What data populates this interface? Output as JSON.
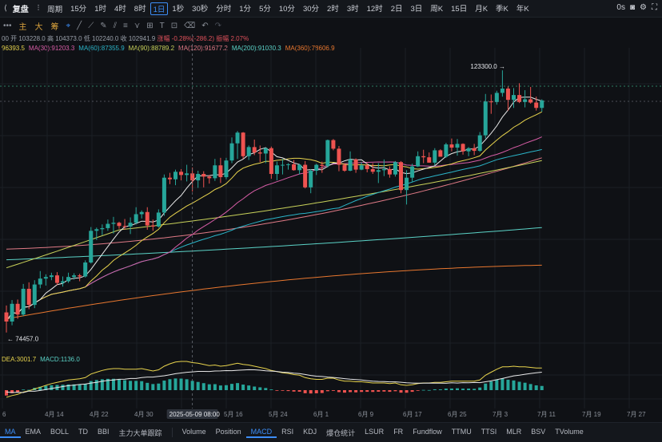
{
  "topbar": {
    "title": "复盘",
    "period_label": "周期",
    "intervals": [
      "15分",
      "1时",
      "4时",
      "8时",
      "1日",
      "1秒",
      "30秒",
      "分时",
      "1分",
      "5分",
      "10分",
      "30分",
      "2时",
      "3时",
      "12时",
      "2日",
      "3日",
      "周K",
      "15日",
      "月K",
      "季K",
      "年K"
    ],
    "active_interval": "1日",
    "right_text": "0s"
  },
  "toolbar": {
    "tabs": [
      "主",
      "大",
      "筹"
    ]
  },
  "ohlc": {
    "prefix": "00",
    "open": "开 103228.0",
    "high": "高 104373.0",
    "low": "低 102240.0",
    "close": "收 102941.9",
    "change": "涨幅 -0.28%(-286.2)",
    "amplitude": "振幅 2.07%"
  },
  "colors": {
    "bull": "#26a69a",
    "bear": "#ef5350",
    "ma7": "#e8e8e8",
    "ma15": "#e8d44d",
    "ma30": "#d75da6",
    "ma60": "#2bb5c9",
    "ma90": "#c9d25a",
    "ma120": "#e07a86",
    "ma200": "#5bd3c7",
    "ma360": "#e8772f",
    "dif": "#e8d44d",
    "dea": "#e8e8e8"
  },
  "ma_legend": [
    {
      "label": "96393.5",
      "color": "#e8d44d"
    },
    {
      "label": "MA(30):91203.3",
      "color": "#d75da6"
    },
    {
      "label": "MA(60):87355.9",
      "color": "#2bb5c9"
    },
    {
      "label": "MA(90):88789.2",
      "color": "#c9d25a"
    },
    {
      "label": "MA(120):91677.2",
      "color": "#e07a86"
    },
    {
      "label": "MA(200):91030.3",
      "color": "#5bd3c7"
    },
    {
      "label": "MA(360):78606.9",
      "color": "#e8772f"
    }
  ],
  "macd_legend": [
    {
      "label": "DEA:3001.7",
      "color": "#e8d44d"
    },
    {
      "label": "MACD:1136.0",
      "color": "#5bd3c7"
    }
  ],
  "chart_data": {
    "type": "candlestick",
    "symbol": "BTC",
    "high_annotation": "123300.0 →",
    "low_annotation": "← 74457.0",
    "crosshair_label": "2025-05-09 08:00",
    "x_ticks": [
      "6",
      "4月 14",
      "4月 22",
      "4月 30",
      "5月 16",
      "5月 24",
      "6月 1",
      "6月 9",
      "6月 17",
      "6月 25",
      "7月 3",
      "7月 11",
      "7月 19",
      "7月 27"
    ],
    "y_range": [
      71000,
      126000
    ],
    "grid": true,
    "dates_start": "2025-04-06",
    "ohlc": [
      [
        78200,
        79500,
        74457,
        76500
      ],
      [
        76500,
        80500,
        75800,
        79800
      ],
      [
        79800,
        80600,
        77000,
        77800
      ],
      [
        77800,
        83500,
        77500,
        82600
      ],
      [
        82600,
        83800,
        78800,
        79600
      ],
      [
        79600,
        84200,
        79000,
        83400
      ],
      [
        83400,
        85900,
        82700,
        84500
      ],
      [
        84500,
        85300,
        83200,
        84800
      ],
      [
        84800,
        85600,
        84200,
        85100
      ],
      [
        85100,
        85700,
        83300,
        83700
      ],
      [
        83700,
        84900,
        83000,
        84000
      ],
      [
        84000,
        85600,
        83700,
        84800
      ],
      [
        84800,
        85500,
        84300,
        85100
      ],
      [
        85100,
        85400,
        84000,
        84900
      ],
      [
        84900,
        87900,
        84700,
        87500
      ],
      [
        87500,
        94100,
        87300,
        93400
      ],
      [
        93400,
        94000,
        91700,
        93700
      ],
      [
        93700,
        94600,
        92600,
        93900
      ],
      [
        93900,
        95500,
        93400,
        94700
      ],
      [
        94700,
        96000,
        92900,
        94900
      ],
      [
        94900,
        95100,
        93800,
        94300
      ],
      [
        94300,
        95600,
        93600,
        94200
      ],
      [
        94200,
        95900,
        92800,
        94900
      ],
      [
        94900,
        97800,
        94600,
        96500
      ],
      [
        96500,
        97200,
        95700,
        96900
      ],
      [
        96900,
        97800,
        93600,
        94400
      ],
      [
        94400,
        95500,
        93400,
        94200
      ],
      [
        94200,
        97400,
        94000,
        96800
      ],
      [
        96800,
        103900,
        96200,
        103300
      ],
      [
        103300,
        104200,
        102100,
        103000
      ],
      [
        103000,
        104800,
        101900,
        104400
      ],
      [
        104400,
        104900,
        102800,
        103800
      ],
      [
        103800,
        105700,
        102600,
        104100
      ],
      [
        104100,
        105200,
        100700,
        102800
      ],
      [
        102800,
        104600,
        101400,
        104000
      ],
      [
        104000,
        104500,
        101500,
        103500
      ],
      [
        103500,
        103800,
        102200,
        103200
      ],
      [
        103200,
        106800,
        102700,
        105600
      ],
      [
        105600,
        107000,
        102300,
        103400
      ],
      [
        103400,
        107000,
        103000,
        106500
      ],
      [
        106500,
        110800,
        106000,
        109700
      ],
      [
        109700,
        112000,
        106800,
        111700
      ],
      [
        111700,
        111800,
        106800,
        107300
      ],
      [
        107300,
        109300,
        106600,
        109000
      ],
      [
        109000,
        110400,
        107500,
        108000
      ],
      [
        108000,
        109300,
        106200,
        107800
      ],
      [
        107800,
        108900,
        106000,
        108800
      ],
      [
        108800,
        109100,
        103100,
        104000
      ],
      [
        104000,
        106300,
        102800,
        105600
      ],
      [
        105600,
        106800,
        103900,
        105700
      ],
      [
        105700,
        106000,
        104800,
        105800
      ],
      [
        105800,
        106600,
        104600,
        104700
      ],
      [
        104700,
        105900,
        103900,
        105700
      ],
      [
        105700,
        106400,
        101300,
        101500
      ],
      [
        101500,
        104900,
        100400,
        104600
      ],
      [
        104600,
        105900,
        103800,
        105700
      ],
      [
        105700,
        106300,
        104200,
        105500
      ],
      [
        105500,
        110400,
        105200,
        110300
      ],
      [
        110300,
        110500,
        108400,
        108700
      ],
      [
        108700,
        109200,
        104500,
        105700
      ],
      [
        105700,
        106000,
        104400,
        104600
      ],
      [
        104600,
        108200,
        104500,
        106700
      ],
      [
        106700,
        106900,
        104200,
        104800
      ],
      [
        104800,
        106200,
        104700,
        105600
      ],
      [
        105600,
        106000,
        104300,
        104900
      ],
      [
        104900,
        106000,
        104000,
        104400
      ],
      [
        104400,
        106000,
        102300,
        104700
      ],
      [
        104700,
        106700,
        103600,
        104900
      ],
      [
        104900,
        105400,
        103300,
        103900
      ],
      [
        103900,
        106400,
        103500,
        106200
      ],
      [
        106200,
        106400,
        100400,
        101000
      ],
      [
        101000,
        104700,
        98300,
        103300
      ],
      [
        103300,
        105900,
        102400,
        105400
      ],
      [
        105400,
        108200,
        105300,
        107300
      ],
      [
        107300,
        108500,
        106000,
        107100
      ],
      [
        107100,
        108000,
        106100,
        106100
      ],
      [
        106100,
        108800,
        105600,
        108400
      ],
      [
        108400,
        108600,
        107400,
        107200
      ],
      [
        107200,
        109800,
        107000,
        109500
      ],
      [
        109500,
        110600,
        108200,
        108900
      ],
      [
        108900,
        110500,
        107400,
        109600
      ],
      [
        109600,
        109700,
        107600,
        108200
      ],
      [
        108200,
        109000,
        107300,
        108800
      ],
      [
        108800,
        109600,
        107500,
        108300
      ],
      [
        108300,
        111800,
        108100,
        111200
      ],
      [
        111200,
        118900,
        110600,
        117500
      ],
      [
        117500,
        118800,
        115200,
        117400
      ],
      [
        117400,
        119500,
        116900,
        119100
      ],
      [
        119100,
        123300,
        118400,
        119900
      ],
      [
        119900,
        120300,
        115800,
        117800
      ],
      [
        117800,
        120000,
        116300,
        118700
      ],
      [
        118700,
        120900,
        117200,
        117400
      ],
      [
        117400,
        119600,
        116400,
        117900
      ],
      [
        117900,
        120200,
        117100,
        117300
      ],
      [
        117300,
        118400,
        115800,
        116300
      ],
      [
        116300,
        117900,
        115600,
        117700
      ]
    ],
    "macd_hist": [
      -900,
      -500,
      -350,
      100,
      60,
      380,
      560,
      710,
      820,
      870,
      900,
      950,
      960,
      960,
      1080,
      1520,
      1700,
      1820,
      1890,
      1900,
      1790,
      1660,
      1550,
      1550,
      1500,
      1220,
      1020,
      1100,
      1600,
      1830,
      1950,
      1930,
      1820,
      1550,
      1370,
      1170,
      980,
      1000,
      780,
      830,
      1050,
      1180,
      930,
      780,
      600,
      470,
      360,
      120,
      -20,
      -100,
      -150,
      -240,
      -260,
      -520,
      -560,
      -530,
      -480,
      -180,
      -120,
      -330,
      -420,
      -330,
      -370,
      -300,
      -280,
      -300,
      -260,
      -240,
      -280,
      -180,
      -420,
      -430,
      -280,
      -60,
      40,
      20,
      140,
      130,
      260,
      270,
      310,
      250,
      260,
      220,
      440,
      1100,
      1450,
      1750,
      1960,
      1740,
      1620,
      1400,
      1240,
      1020,
      800,
      700
    ],
    "dif_line": [
      -1200,
      -900,
      -700,
      -300,
      -100,
      200,
      500,
      800,
      1100,
      1300,
      1500,
      1700,
      1800,
      1900,
      2100,
      2700,
      3000,
      3300,
      3500,
      3600,
      3600,
      3500,
      3500,
      3500,
      3600,
      3400,
      3200,
      3400,
      4000,
      4400,
      4700,
      4800,
      4800,
      4600,
      4500,
      4300,
      4100,
      4200,
      4000,
      4100,
      4300,
      4500,
      4300,
      4200,
      4000,
      3800,
      3600,
      3300,
      3100,
      2900,
      2800,
      2600,
      2500,
      2100,
      1900,
      1800,
      1800,
      2000,
      2000,
      1700,
      1500,
      1500,
      1400,
      1400,
      1300,
      1200,
      1200,
      1200,
      1100,
      1200,
      900,
      800,
      900,
      1100,
      1200,
      1200,
      1300,
      1300,
      1400,
      1500,
      1500,
      1500,
      1500,
      1500,
      1700,
      2500,
      3000,
      3500,
      3900,
      3900,
      4000,
      3900,
      3900,
      3800,
      3700,
      3700
    ],
    "dea_line": [
      -300,
      -400,
      -350,
      -400,
      -160,
      -180,
      -60,
      90,
      280,
      430,
      600,
      750,
      840,
      940,
      1020,
      1180,
      1300,
      1480,
      1610,
      1700,
      1810,
      1840,
      1950,
      1950,
      2100,
      2180,
      2180,
      2300,
      2400,
      2570,
      2750,
      2870,
      2980,
      3050,
      3130,
      3130,
      3120,
      3200,
      3220,
      3270,
      3250,
      3320,
      3370,
      3420,
      3400,
      3330,
      3240,
      3180,
      3120,
      3000,
      2950,
      2840,
      2760,
      2620,
      2460,
      2330,
      2280,
      2180,
      2120,
      2030,
      1920,
      1830,
      1770,
      1700,
      1580,
      1500,
      1460,
      1440,
      1380,
      1380,
      1320,
      1230,
      1180,
      1160,
      1160,
      1180,
      1160,
      1170,
      1140,
      1230,
      1190,
      1250,
      1240,
      1280,
      1260,
      1400,
      1550,
      1750,
      1940,
      2160,
      2380,
      2500,
      2660,
      2780,
      2900,
      3001.7
    ]
  },
  "bottombar": {
    "left": [
      "MA",
      "EMA",
      "BOLL",
      "TD",
      "BBI",
      "主力大单跟踪"
    ],
    "right": [
      "Volume",
      "Position",
      "MACD",
      "RSI",
      "KDJ",
      "爆仓统计",
      "LSUR",
      "FR",
      "Fundflow",
      "TTMU",
      "TTSI",
      "MLR",
      "BSV",
      "TVolume"
    ],
    "active_left": "MA",
    "active_right": "MACD"
  }
}
